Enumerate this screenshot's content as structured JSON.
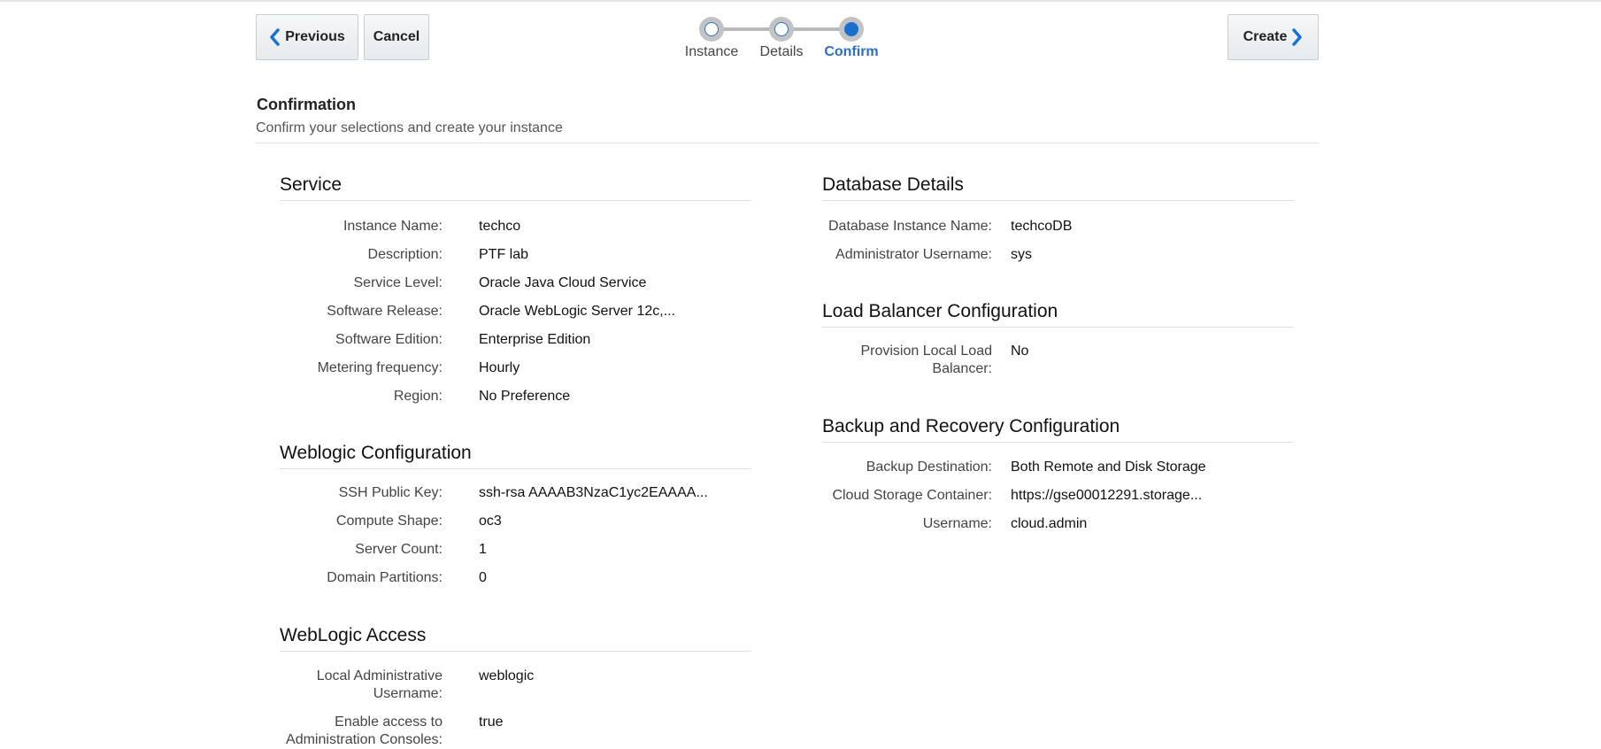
{
  "nav": {
    "previous_label": "Previous",
    "cancel_label": "Cancel",
    "create_label": "Create",
    "accent_color": "#1a6fcf"
  },
  "train": {
    "steps": [
      {
        "label": "Instance",
        "state": "visited"
      },
      {
        "label": "Details",
        "state": "visited"
      },
      {
        "label": "Confirm",
        "state": "current"
      }
    ]
  },
  "header": {
    "title": "Confirmation",
    "subtitle": "Confirm your selections and create your instance"
  },
  "left_sections": [
    {
      "title": "Service",
      "fields": [
        {
          "label": "Instance Name:",
          "value": "techco"
        },
        {
          "label": "Description:",
          "value": "PTF lab"
        },
        {
          "label": "Service Level:",
          "value": "Oracle Java Cloud Service"
        },
        {
          "label": "Software Release:",
          "value": "Oracle WebLogic Server 12c,..."
        },
        {
          "label": "Software Edition:",
          "value": "Enterprise Edition"
        },
        {
          "label": "Metering frequency:",
          "value": "Hourly"
        },
        {
          "label": "Region:",
          "value": "No Preference"
        }
      ]
    },
    {
      "title": "Weblogic Configuration",
      "fields": [
        {
          "label": "SSH Public Key:",
          "value": "ssh-rsa AAAAB3NzaC1yc2EAAAA..."
        },
        {
          "label": "Compute Shape:",
          "value": "oc3"
        },
        {
          "label": "Server Count:",
          "value": "1"
        },
        {
          "label": "Domain Partitions:",
          "value": "0"
        }
      ]
    },
    {
      "title": "WebLogic Access",
      "fields": [
        {
          "label_lines": [
            "Local Administrative",
            "Username:"
          ],
          "value": "weblogic"
        },
        {
          "label_lines": [
            "Enable access to",
            "Administration Consoles:"
          ],
          "value": "true"
        }
      ]
    }
  ],
  "right_sections": [
    {
      "title": "Database Details",
      "fields": [
        {
          "label": "Database Instance Name:",
          "value": "techcoDB"
        },
        {
          "label": "Administrator Username:",
          "value": "sys"
        }
      ]
    },
    {
      "title": "Load Balancer Configuration",
      "fields": [
        {
          "label_lines": [
            "Provision Local Load",
            "Balancer:"
          ],
          "value": "No"
        }
      ]
    },
    {
      "title": "Backup and Recovery Configuration",
      "fields": [
        {
          "label": "Backup Destination:",
          "value": "Both Remote and Disk Storage"
        },
        {
          "label": "Cloud Storage Container:",
          "value": "https://gse00012291.storage..."
        },
        {
          "label": "Username:",
          "value": "cloud.admin"
        }
      ]
    }
  ]
}
